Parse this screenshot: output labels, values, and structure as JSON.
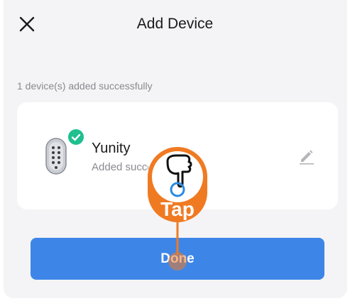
{
  "header": {
    "title": "Add Device",
    "close_icon": "close-icon"
  },
  "status": {
    "message": "1 device(s) added successfully"
  },
  "device": {
    "name": "Yunity",
    "status_text": "Added successfully",
    "image_icon": "smart-lock-icon",
    "badge_icon": "check-circle-icon",
    "badge_color": "#1fbf8f",
    "edit_icon": "pencil-icon"
  },
  "actions": {
    "done_label": "Done",
    "accent_color": "#3d86e8"
  },
  "hint_overlay": {
    "label": "Tap",
    "icon": "pointing-hand-icon",
    "color": "#f07a22"
  }
}
